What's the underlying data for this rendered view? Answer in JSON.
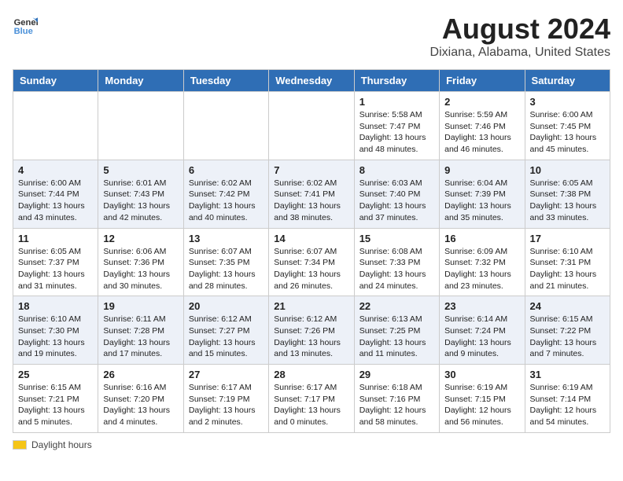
{
  "header": {
    "logo_line1": "General",
    "logo_line2": "Blue",
    "title": "August 2024",
    "subtitle": "Dixiana, Alabama, United States"
  },
  "days_of_week": [
    "Sunday",
    "Monday",
    "Tuesday",
    "Wednesday",
    "Thursday",
    "Friday",
    "Saturday"
  ],
  "weeks": [
    [
      {
        "day": "",
        "info": ""
      },
      {
        "day": "",
        "info": ""
      },
      {
        "day": "",
        "info": ""
      },
      {
        "day": "",
        "info": ""
      },
      {
        "day": "1",
        "info": "Sunrise: 5:58 AM\nSunset: 7:47 PM\nDaylight: 13 hours and 48 minutes."
      },
      {
        "day": "2",
        "info": "Sunrise: 5:59 AM\nSunset: 7:46 PM\nDaylight: 13 hours and 46 minutes."
      },
      {
        "day": "3",
        "info": "Sunrise: 6:00 AM\nSunset: 7:45 PM\nDaylight: 13 hours and 45 minutes."
      }
    ],
    [
      {
        "day": "4",
        "info": "Sunrise: 6:00 AM\nSunset: 7:44 PM\nDaylight: 13 hours and 43 minutes."
      },
      {
        "day": "5",
        "info": "Sunrise: 6:01 AM\nSunset: 7:43 PM\nDaylight: 13 hours and 42 minutes."
      },
      {
        "day": "6",
        "info": "Sunrise: 6:02 AM\nSunset: 7:42 PM\nDaylight: 13 hours and 40 minutes."
      },
      {
        "day": "7",
        "info": "Sunrise: 6:02 AM\nSunset: 7:41 PM\nDaylight: 13 hours and 38 minutes."
      },
      {
        "day": "8",
        "info": "Sunrise: 6:03 AM\nSunset: 7:40 PM\nDaylight: 13 hours and 37 minutes."
      },
      {
        "day": "9",
        "info": "Sunrise: 6:04 AM\nSunset: 7:39 PM\nDaylight: 13 hours and 35 minutes."
      },
      {
        "day": "10",
        "info": "Sunrise: 6:05 AM\nSunset: 7:38 PM\nDaylight: 13 hours and 33 minutes."
      }
    ],
    [
      {
        "day": "11",
        "info": "Sunrise: 6:05 AM\nSunset: 7:37 PM\nDaylight: 13 hours and 31 minutes."
      },
      {
        "day": "12",
        "info": "Sunrise: 6:06 AM\nSunset: 7:36 PM\nDaylight: 13 hours and 30 minutes."
      },
      {
        "day": "13",
        "info": "Sunrise: 6:07 AM\nSunset: 7:35 PM\nDaylight: 13 hours and 28 minutes."
      },
      {
        "day": "14",
        "info": "Sunrise: 6:07 AM\nSunset: 7:34 PM\nDaylight: 13 hours and 26 minutes."
      },
      {
        "day": "15",
        "info": "Sunrise: 6:08 AM\nSunset: 7:33 PM\nDaylight: 13 hours and 24 minutes."
      },
      {
        "day": "16",
        "info": "Sunrise: 6:09 AM\nSunset: 7:32 PM\nDaylight: 13 hours and 23 minutes."
      },
      {
        "day": "17",
        "info": "Sunrise: 6:10 AM\nSunset: 7:31 PM\nDaylight: 13 hours and 21 minutes."
      }
    ],
    [
      {
        "day": "18",
        "info": "Sunrise: 6:10 AM\nSunset: 7:30 PM\nDaylight: 13 hours and 19 minutes."
      },
      {
        "day": "19",
        "info": "Sunrise: 6:11 AM\nSunset: 7:28 PM\nDaylight: 13 hours and 17 minutes."
      },
      {
        "day": "20",
        "info": "Sunrise: 6:12 AM\nSunset: 7:27 PM\nDaylight: 13 hours and 15 minutes."
      },
      {
        "day": "21",
        "info": "Sunrise: 6:12 AM\nSunset: 7:26 PM\nDaylight: 13 hours and 13 minutes."
      },
      {
        "day": "22",
        "info": "Sunrise: 6:13 AM\nSunset: 7:25 PM\nDaylight: 13 hours and 11 minutes."
      },
      {
        "day": "23",
        "info": "Sunrise: 6:14 AM\nSunset: 7:24 PM\nDaylight: 13 hours and 9 minutes."
      },
      {
        "day": "24",
        "info": "Sunrise: 6:15 AM\nSunset: 7:22 PM\nDaylight: 13 hours and 7 minutes."
      }
    ],
    [
      {
        "day": "25",
        "info": "Sunrise: 6:15 AM\nSunset: 7:21 PM\nDaylight: 13 hours and 5 minutes."
      },
      {
        "day": "26",
        "info": "Sunrise: 6:16 AM\nSunset: 7:20 PM\nDaylight: 13 hours and 4 minutes."
      },
      {
        "day": "27",
        "info": "Sunrise: 6:17 AM\nSunset: 7:19 PM\nDaylight: 13 hours and 2 minutes."
      },
      {
        "day": "28",
        "info": "Sunrise: 6:17 AM\nSunset: 7:17 PM\nDaylight: 13 hours and 0 minutes."
      },
      {
        "day": "29",
        "info": "Sunrise: 6:18 AM\nSunset: 7:16 PM\nDaylight: 12 hours and 58 minutes."
      },
      {
        "day": "30",
        "info": "Sunrise: 6:19 AM\nSunset: 7:15 PM\nDaylight: 12 hours and 56 minutes."
      },
      {
        "day": "31",
        "info": "Sunrise: 6:19 AM\nSunset: 7:14 PM\nDaylight: 12 hours and 54 minutes."
      }
    ]
  ],
  "footer": {
    "daylight_label": "Daylight hours"
  }
}
